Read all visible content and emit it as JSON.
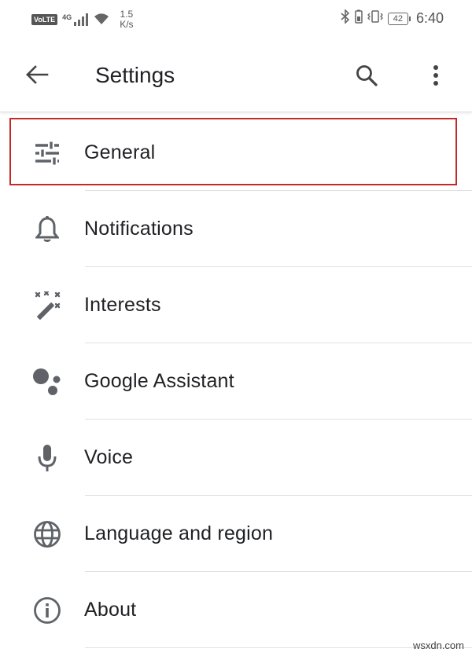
{
  "status_bar": {
    "volte": "VoLTE",
    "network": "4G",
    "speed_value": "1.5",
    "speed_unit": "K/s",
    "battery": "42",
    "time": "6:40"
  },
  "app_bar": {
    "title": "Settings",
    "back_icon": "arrow-back-icon",
    "search_icon": "search-icon",
    "more_icon": "more-vert-icon"
  },
  "items": [
    {
      "label": "General",
      "icon": "tune-icon",
      "highlighted": true
    },
    {
      "label": "Notifications",
      "icon": "bell-icon"
    },
    {
      "label": "Interests",
      "icon": "magic-wand-icon"
    },
    {
      "label": "Google Assistant",
      "icon": "assistant-icon"
    },
    {
      "label": "Voice",
      "icon": "microphone-icon"
    },
    {
      "label": "Language and region",
      "icon": "globe-icon"
    },
    {
      "label": "About",
      "icon": "info-icon"
    }
  ],
  "highlight_color": "#c62828",
  "icon_color": "#5f6368",
  "watermark": "wsxdn.com"
}
